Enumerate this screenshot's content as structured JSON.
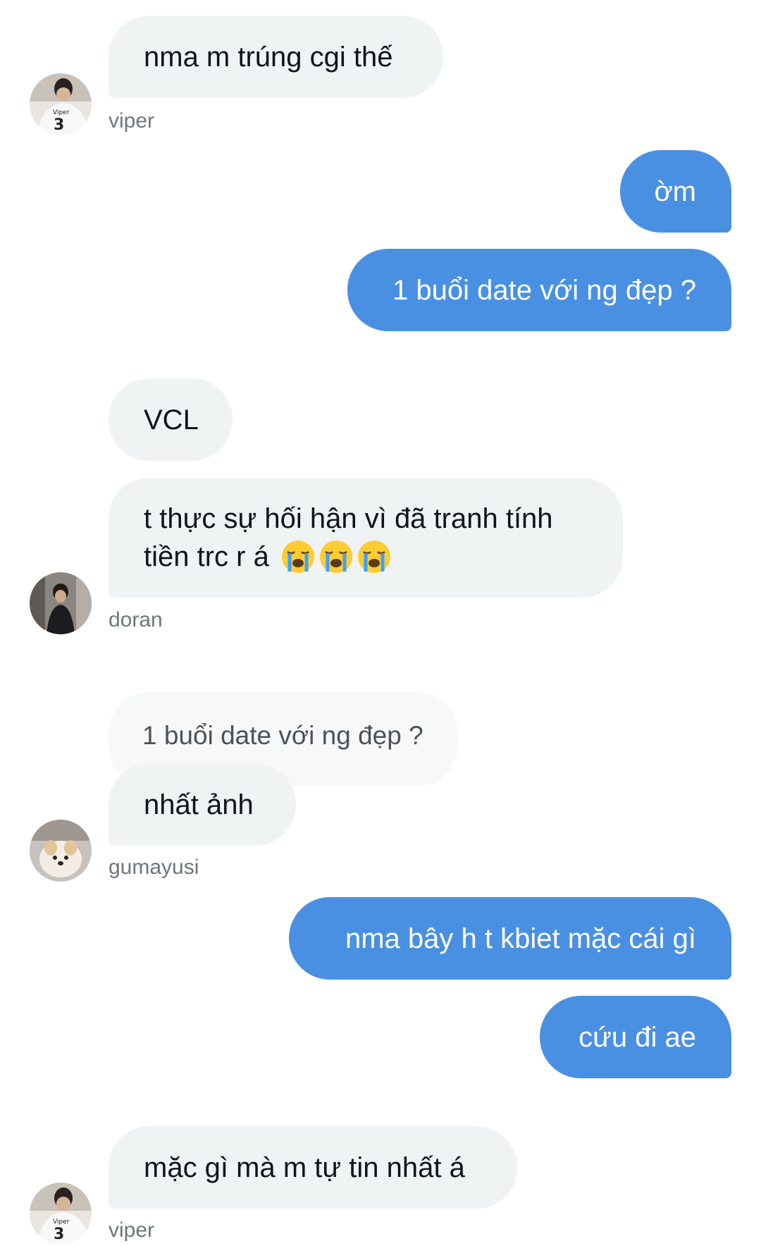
{
  "messages": [
    {
      "text": "nma m trúng cgi thế",
      "sender": "viper"
    },
    {
      "text": "ờm"
    },
    {
      "text": "1 buổi date với ng đẹp ?"
    },
    {
      "text": "VCL"
    },
    {
      "text": "t thực sự hối hận vì đã tranh tính",
      "text2": "tiền trc r á",
      "emoji": "loudly-crying-face-icon",
      "sender": "doran"
    },
    {
      "quote": "1 buổi date với ng đẹp ?",
      "text": "nhất ảnh",
      "sender": "gumayusi"
    },
    {
      "text": "nma bây h t kbiet mặc cái gì"
    },
    {
      "text": "cứu đi ae"
    },
    {
      "text": "mặc gì mà m tự tin nhất á",
      "sender": "viper"
    }
  ],
  "avatars": {
    "viper": {
      "jersey_name": "Viper",
      "jersey_number": "3"
    }
  },
  "colors": {
    "outgoing_bubble": "#4a90e2",
    "incoming_bubble": "#eff3f4",
    "sender_label": "#6e767d"
  }
}
